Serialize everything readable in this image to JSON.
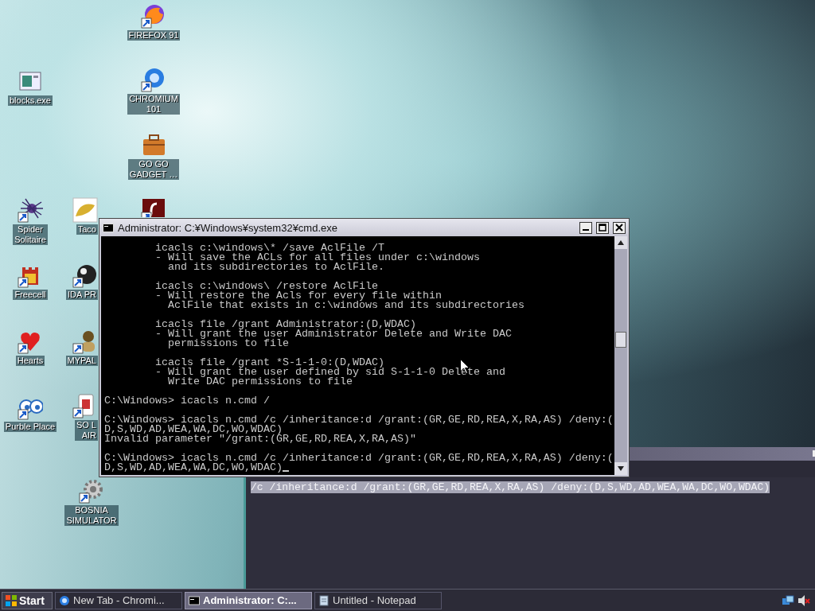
{
  "desktop_icons": [
    {
      "label": [
        "FIREFOX 91"
      ],
      "shortcut": true
    },
    {
      "label": [
        "blocks.exe"
      ],
      "shortcut": false
    },
    {
      "label": [
        "CHROMIUM",
        "101"
      ],
      "shortcut": true
    },
    {
      "label": [
        "GO GO",
        "GADGET …"
      ],
      "shortcut": false
    },
    {
      "label": [
        "Spider",
        "Solitaire"
      ],
      "shortcut": true
    },
    {
      "label": [
        "Taco"
      ],
      "shortcut": false
    },
    {
      "shortcut": true
    },
    {
      "label": [
        "Freecell"
      ],
      "shortcut": true
    },
    {
      "label": [
        "IDA PR"
      ],
      "shortcut": true
    },
    {
      "label": [
        "Hearts"
      ],
      "shortcut": true
    },
    {
      "label": [
        "MYPAL"
      ],
      "shortcut": true
    },
    {
      "label": [
        "Purble Place"
      ],
      "shortcut": true
    },
    {
      "label": [
        "SO L",
        "AIR"
      ],
      "shortcut": true
    },
    {
      "label": [
        "BOSNIA",
        "SIMULATOR"
      ],
      "shortcut": true
    }
  ],
  "notepad": {
    "selected_text": "/c /inheritance:d /grant:(GR,GE,RD,REA,X,RA,AS) /deny:(D,S,WD,AD,WEA,WA,DC,WO,WDAC)"
  },
  "cmd_window": {
    "title": "Administrator: C:¥Windows¥system32¥cmd.exe",
    "blocks": [
      {
        "lines": [
          "        icacls c:\\windows\\* /save AclFile /T",
          "        - Will save the ACLs for all files under c:\\windows",
          "          and its subdirectories to AclFile."
        ]
      },
      {
        "lines": [
          "        icacls c:\\windows\\ /restore AclFile",
          "        - Will restore the Acls for every file within",
          "          AclFile that exists in c:\\windows and its subdirectories"
        ]
      },
      {
        "lines": [
          "        icacls file /grant Administrator:(D,WDAC)",
          "        - Will grant the user Administrator Delete and Write DAC",
          "          permissions to file"
        ]
      },
      {
        "lines": [
          "        icacls file /grant *S-1-1-0:(D,WDAC)",
          "        - Will grant the user defined by sid S-1-1-0 Delete and",
          "          Write DAC permissions to file"
        ]
      },
      {
        "lines": [
          "C:\\Windows> icacls n.cmd /"
        ]
      },
      {
        "lines": [
          "C:\\Windows> icacls n.cmd /c /inheritance:d /grant:(GR,GE,RD,REA,X,RA,AS) /deny:(",
          "D,S,WD,AD,WEA,WA,DC,WO,WDAC)",
          "Invalid parameter \"/grant:(GR,GE,RD,REA,X,RA,AS)\""
        ]
      },
      {
        "lines": [
          "C:\\Windows> icacls n.cmd /c /inheritance:d /grant:(GR,GE,RD,REA,X,RA,AS) /deny:(",
          "D,S,WD,AD,WEA,WA,DC,WO,WDAC)"
        ]
      }
    ]
  },
  "taskbar": {
    "start": "Start",
    "tasks": [
      {
        "label": "New Tab - Chromi...",
        "selected": false
      },
      {
        "label": "Administrator: C:...",
        "selected": true
      },
      {
        "label": "Untitled - Notepad",
        "selected": false
      }
    ]
  }
}
